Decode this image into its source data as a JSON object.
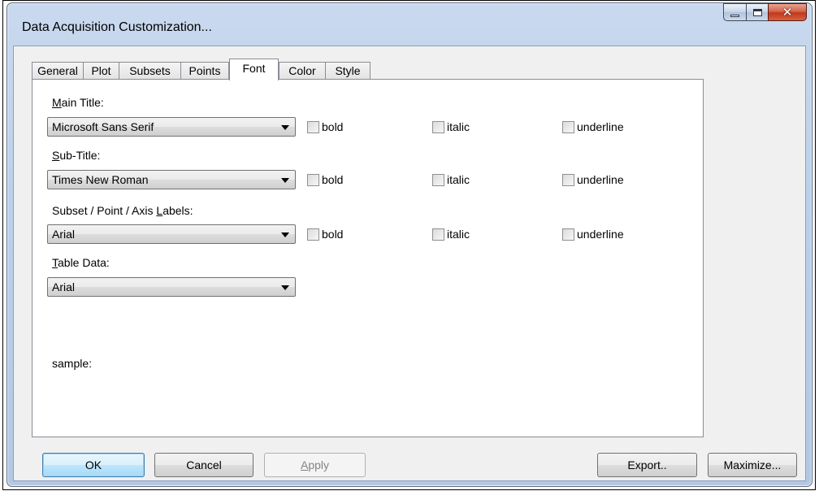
{
  "window": {
    "title": "Data Acquisition Customization..."
  },
  "tabs": [
    {
      "label": "General",
      "active": false
    },
    {
      "label": "Plot",
      "active": false
    },
    {
      "label": "Subsets",
      "active": false
    },
    {
      "label": "Points",
      "active": false
    },
    {
      "label": "Font",
      "active": true
    },
    {
      "label": "Color",
      "active": false
    },
    {
      "label": "Style",
      "active": false
    }
  ],
  "font_tab": {
    "main_title": {
      "label_accel": "M",
      "label_rest": "ain Title:",
      "font": "Microsoft Sans Serif",
      "bold": "bold",
      "italic": "italic",
      "underline": "underline"
    },
    "sub_title": {
      "label_accel": "S",
      "label_rest": "ub-Title:",
      "font": "Times New Roman",
      "bold": "bold",
      "italic": "italic",
      "underline": "underline"
    },
    "axis_labels": {
      "label_pre": "Subset / Point / Axis ",
      "label_accel": "L",
      "label_rest": "abels:",
      "font": "Arial",
      "bold": "bold",
      "italic": "italic",
      "underline": "underline"
    },
    "table_data": {
      "label_accel": "T",
      "label_rest": "able Data:",
      "font": "Arial"
    },
    "sample_label": "sample:"
  },
  "buttons": {
    "ok": "OK",
    "cancel": "Cancel",
    "apply_accel": "A",
    "apply_rest": "pply",
    "export": "Export..",
    "maximize": "Maximize..."
  },
  "icons": {
    "minimize": "minimize-icon",
    "maximize": "maximize-icon",
    "close": "close-icon"
  },
  "colors": {
    "close_button": "#c2371c",
    "default_button": "#3c7fb1",
    "window_frame": "#b3c8e4"
  }
}
